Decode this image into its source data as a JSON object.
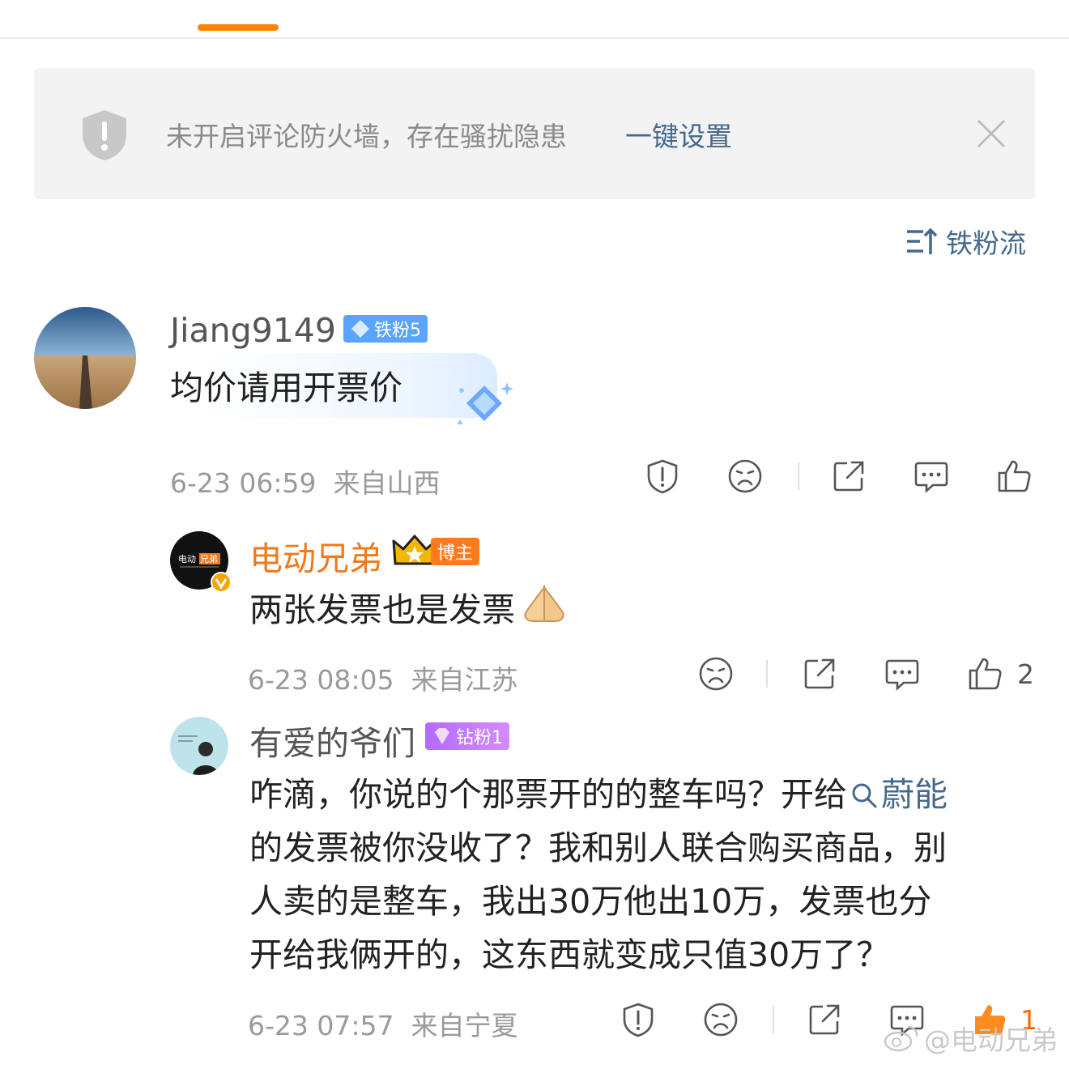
{
  "banner": {
    "warning_text": "未开启评论防火墙，存在骚扰隐患",
    "action_link": "一键设置"
  },
  "sort": {
    "label": "铁粉流"
  },
  "comments": [
    {
      "username": "Jiang9149",
      "badge": "铁粉5",
      "text": "均价请用开票价",
      "time": "6-23 06:59",
      "location": "来自山西"
    }
  ],
  "replies": [
    {
      "username": "电动兄弟",
      "badge": "博主",
      "text": "两张发票也是发票",
      "time": "6-23 08:05",
      "location": "来自江苏",
      "likes": "2"
    },
    {
      "username": "有爱的爷们",
      "badge": "钻粉1",
      "text_line1_prefix": "咋滴，你说的个那票开的的整车吗？开给",
      "search_link": "蔚能",
      "text_line2": "的发票被你没收了？我和别人联合购买商品，别",
      "text_line3": "人卖的是整车，我出30万他出10万，发票也分",
      "text_line4": "开给我俩开的，这东西就变成只值30万了？",
      "time": "6-23 07:57",
      "location": "来自宁夏",
      "likes": "1"
    }
  ],
  "watermark": "@电动兄弟",
  "colors": {
    "accent": "#ff8200",
    "link": "#45698c",
    "blogger_name": "#f07a1a"
  }
}
